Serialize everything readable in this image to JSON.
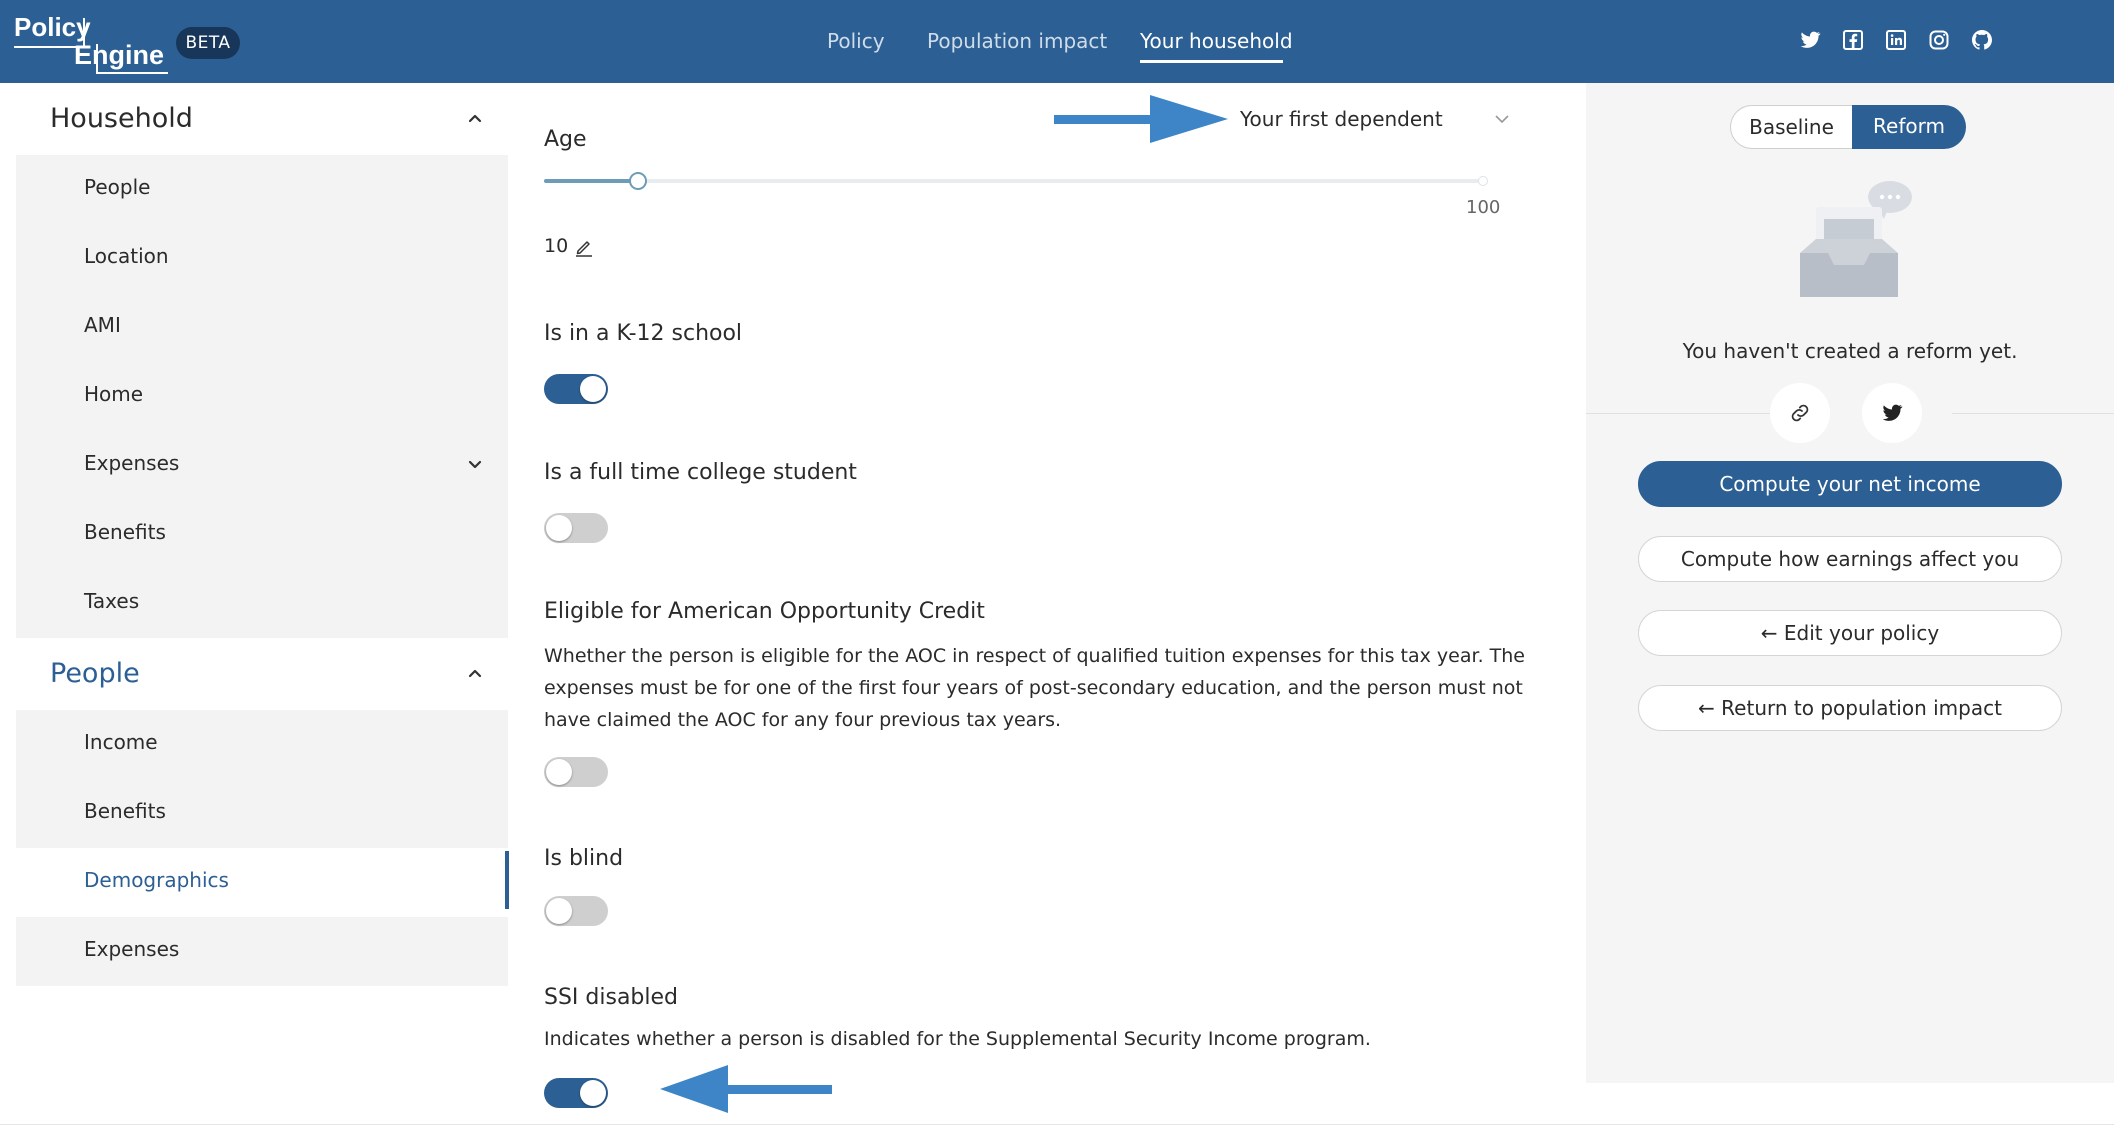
{
  "header": {
    "logo_line1": "Policy",
    "logo_line2": "Engine",
    "badge": "BETA",
    "nav": [
      {
        "label": "Policy",
        "active": false
      },
      {
        "label": "Population impact",
        "active": false
      },
      {
        "label": "Your household",
        "active": true
      }
    ],
    "social_icons": [
      "twitter-icon",
      "facebook-icon",
      "linkedin-icon",
      "instagram-icon",
      "github-icon"
    ]
  },
  "sidebar": {
    "sections": [
      {
        "title": "Household",
        "items": [
          {
            "label": "People"
          },
          {
            "label": "Location"
          },
          {
            "label": "AMI"
          },
          {
            "label": "Home"
          },
          {
            "label": "Expenses",
            "expandable": true
          },
          {
            "label": "Benefits"
          },
          {
            "label": "Taxes"
          }
        ]
      },
      {
        "title": "People",
        "items": [
          {
            "label": "Income"
          },
          {
            "label": "Benefits"
          },
          {
            "label": "Demographics",
            "active": true
          },
          {
            "label": "Expenses"
          }
        ]
      }
    ]
  },
  "main": {
    "person_selector": "Your first dependent",
    "age": {
      "label": "Age",
      "value": "10",
      "max_label": "100",
      "fraction": 0.1
    },
    "fields": [
      {
        "label": "Is in a K-12 school",
        "on": true
      },
      {
        "label": "Is a full time college student",
        "on": false
      },
      {
        "label": "Eligible for American Opportunity Credit",
        "description": "Whether the person is eligible for the AOC in respect of qualified tuition expenses for this tax year. The expenses must be for one of the first four years of post-secondary education, and the person must not have claimed the AOC for any four previous tax years.",
        "on": false
      },
      {
        "label": "Is blind",
        "on": false
      },
      {
        "label": "SSI disabled",
        "description": "Indicates whether a person is disabled for the Supplemental Security Income program.",
        "on": true
      }
    ]
  },
  "right_panel": {
    "toggle": {
      "baseline": "Baseline",
      "reform": "Reform",
      "selected": "reform"
    },
    "empty_message": "You haven't created a reform yet.",
    "share_icons": [
      "link-icon",
      "twitter-icon"
    ],
    "buttons": [
      {
        "label": "Compute your net income",
        "primary": true
      },
      {
        "label": "Compute how earnings affect you",
        "primary": false
      },
      {
        "label": "Edit your policy",
        "primary": false,
        "icon": "arrow-left-icon"
      },
      {
        "label": "Return to population impact",
        "primary": false,
        "icon": "arrow-left-icon"
      }
    ]
  },
  "colors": {
    "brand": "#2c5f93",
    "annotation_arrow": "#3d85c6",
    "toggle_off": "#cfcfcf",
    "sidebar_bg": "#f3f3f4"
  }
}
